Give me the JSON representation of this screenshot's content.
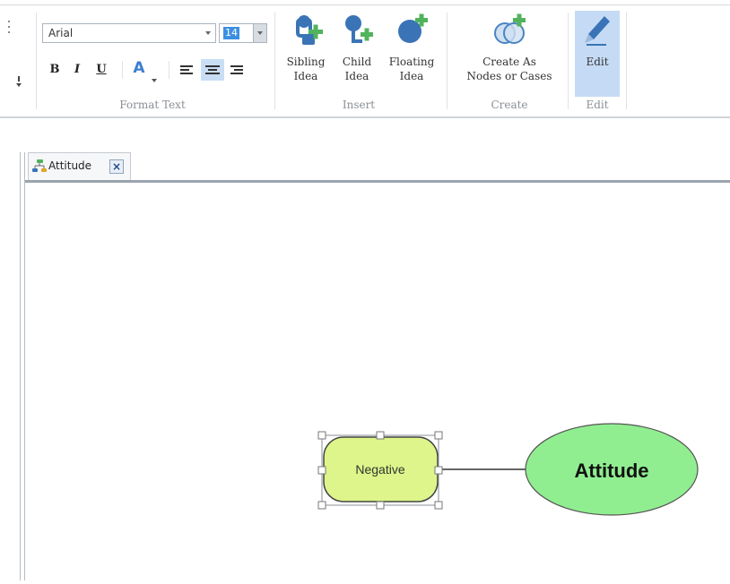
{
  "ribbon": {
    "format_text": {
      "font_name": "Arial",
      "font_size": "14",
      "bold": "B",
      "italic": "I",
      "underline": "U",
      "font_color": "A",
      "group_label": "Format Text"
    },
    "insert": {
      "sibling_label_1": "Sibling",
      "sibling_label_2": "Idea",
      "child_label_1": "Child",
      "child_label_2": "Idea",
      "floating_label_1": "Floating",
      "floating_label_2": "Idea",
      "group_label": "Insert"
    },
    "create": {
      "label_1": "Create As",
      "label_2": "Nodes or Cases",
      "group_label": "Create"
    },
    "edit": {
      "label": "Edit",
      "group_label": "Edit"
    }
  },
  "tab": {
    "label": "Attitude"
  },
  "mindmap": {
    "nodes": [
      {
        "id": "attitude",
        "label": "Attitude",
        "shape": "ellipse",
        "fill": "#90ee90",
        "bold": true
      },
      {
        "id": "negative",
        "label": "Negative",
        "shape": "rounded-rect",
        "fill": "#ddf58a",
        "selected": true
      }
    ],
    "edges": [
      [
        "negative",
        "attitude"
      ]
    ]
  },
  "colors": {
    "accent_selected": "#c5dbf5",
    "icon_blue": "#3a74b6",
    "icon_green": "#51b35b"
  }
}
